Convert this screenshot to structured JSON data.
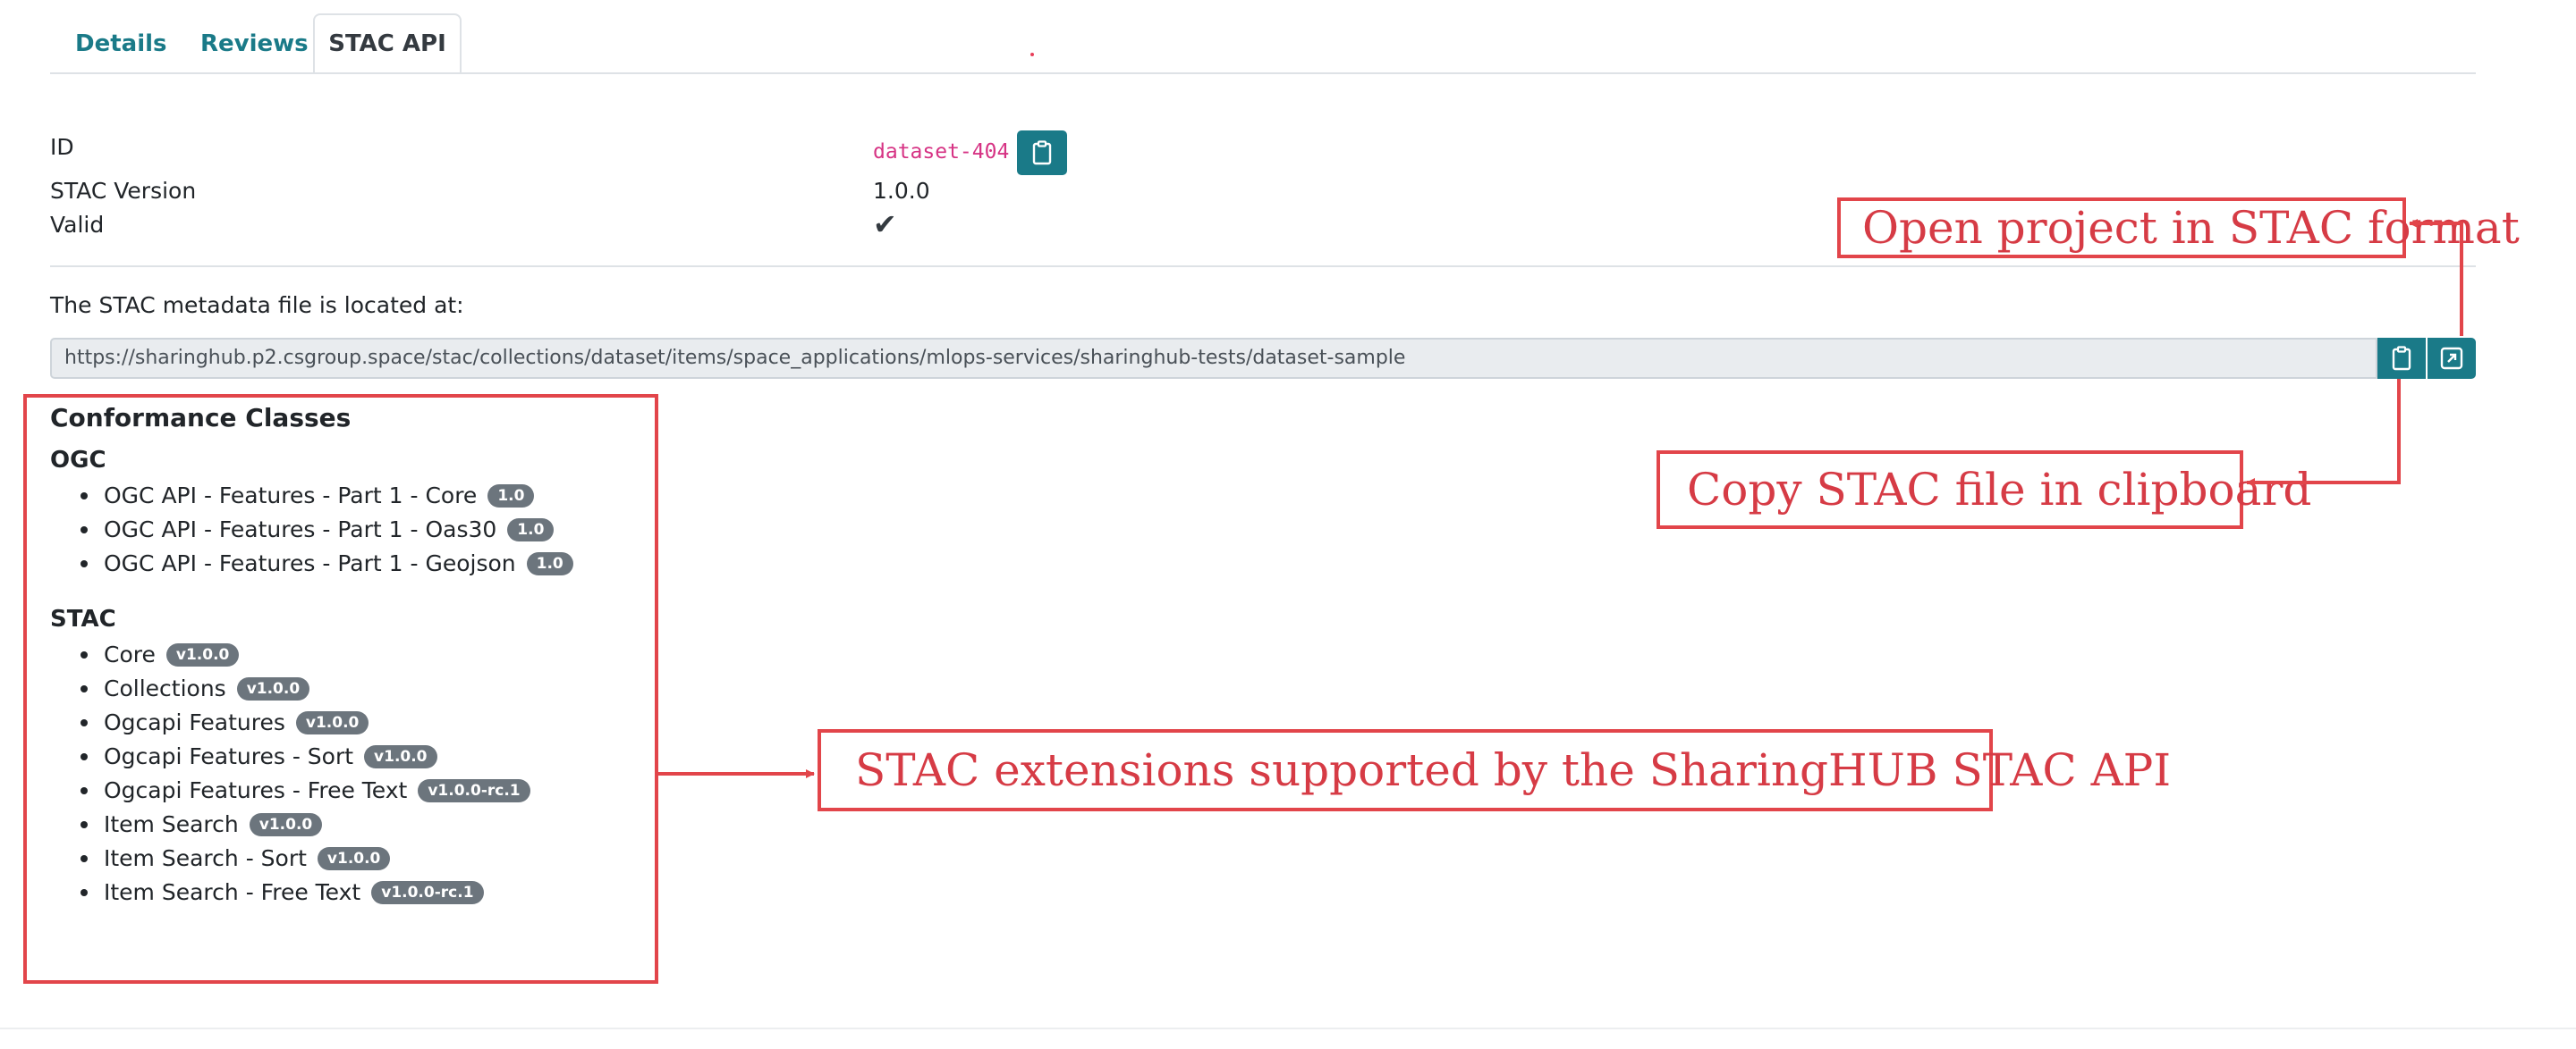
{
  "tabs": [
    {
      "label": "Details",
      "active": false
    },
    {
      "label": "Reviews",
      "active": false
    },
    {
      "label": "STAC API",
      "active": true
    }
  ],
  "properties": {
    "id_label": "ID",
    "id_value": "dataset-404",
    "version_label": "STAC Version",
    "version_value": "1.0.0",
    "valid_label": "Valid",
    "valid_value": "✔"
  },
  "metadata": {
    "label": "The STAC metadata file is located at:",
    "url": "https://sharinghub.p2.csgroup.space/stac/collections/dataset/items/space_applications/mlops-services/sharinghub-tests/dataset-sample"
  },
  "conformance": {
    "title": "Conformance Classes",
    "groups": [
      {
        "name": "OGC",
        "items": [
          {
            "label": "OGC API - Features - Part 1 - Core",
            "version": "1.0"
          },
          {
            "label": "OGC API - Features - Part 1 - Oas30",
            "version": "1.0"
          },
          {
            "label": "OGC API - Features - Part 1 - Geojson",
            "version": "1.0"
          }
        ]
      },
      {
        "name": "STAC",
        "items": [
          {
            "label": "Core",
            "version": "v1.0.0"
          },
          {
            "label": "Collections",
            "version": "v1.0.0"
          },
          {
            "label": "Ogcapi Features",
            "version": "v1.0.0"
          },
          {
            "label": "Ogcapi Features - Sort",
            "version": "v1.0.0"
          },
          {
            "label": "Ogcapi Features - Free Text",
            "version": "v1.0.0-rc.1"
          },
          {
            "label": "Item Search",
            "version": "v1.0.0"
          },
          {
            "label": "Item Search - Sort",
            "version": "v1.0.0"
          },
          {
            "label": "Item Search - Free Text",
            "version": "v1.0.0-rc.1"
          }
        ]
      }
    ]
  },
  "annotations": {
    "open_stac": "Open project in STAC format",
    "copy_stac": "Copy STAC file in clipboard",
    "extensions": "STAC extensions supported by the SharingHUB STAC API"
  },
  "colors": {
    "accent": "#1a7a88",
    "annotation": "#e2454a",
    "badge": "#6c757d",
    "code": "#d63384"
  },
  "icons": {
    "copy": "clipboard-icon",
    "open": "external-link-icon"
  }
}
